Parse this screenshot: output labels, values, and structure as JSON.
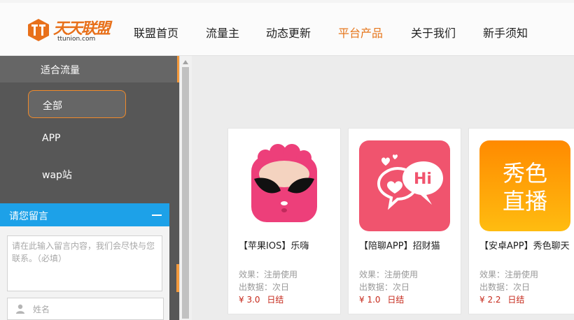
{
  "logo": {
    "name": "天天联盟",
    "domain": "ttunion.com"
  },
  "nav": [
    "联盟首页",
    "流量主",
    "动态更新",
    "平台产品",
    "关于我们",
    "新手须知"
  ],
  "nav_active": "平台产品",
  "sidebar": {
    "title": "适合流量",
    "items": [
      "全部",
      "APP",
      "wap站"
    ]
  },
  "message": {
    "title": "请您留言",
    "placeholder": "请在此输入留言内容，我们会尽快与您联系。（必填）",
    "name_placeholder": "姓名"
  },
  "products": [
    {
      "title": "【苹果IOS】乐嗨",
      "effect": "效果：注册使用",
      "data_time": "出数据：次日",
      "price": "¥ 3.0",
      "settle": "日结"
    },
    {
      "title": "【陪聊APP】招财猫",
      "effect": "效果：注册使用",
      "data_time": "出数据：次日",
      "price": "¥ 1.0",
      "settle": "日结"
    },
    {
      "title": "【安卓APP】秀色聊天",
      "effect": "效果：注册使用",
      "data_time": "出数据：次日",
      "price": "¥ 2.2",
      "settle": "日结",
      "icon_text": [
        "秀色",
        "直播"
      ]
    }
  ],
  "colors": {
    "accent": "#e6761b",
    "sidebar": "#575757",
    "message_header": "#1da1e8",
    "price": "#c62a1c"
  }
}
